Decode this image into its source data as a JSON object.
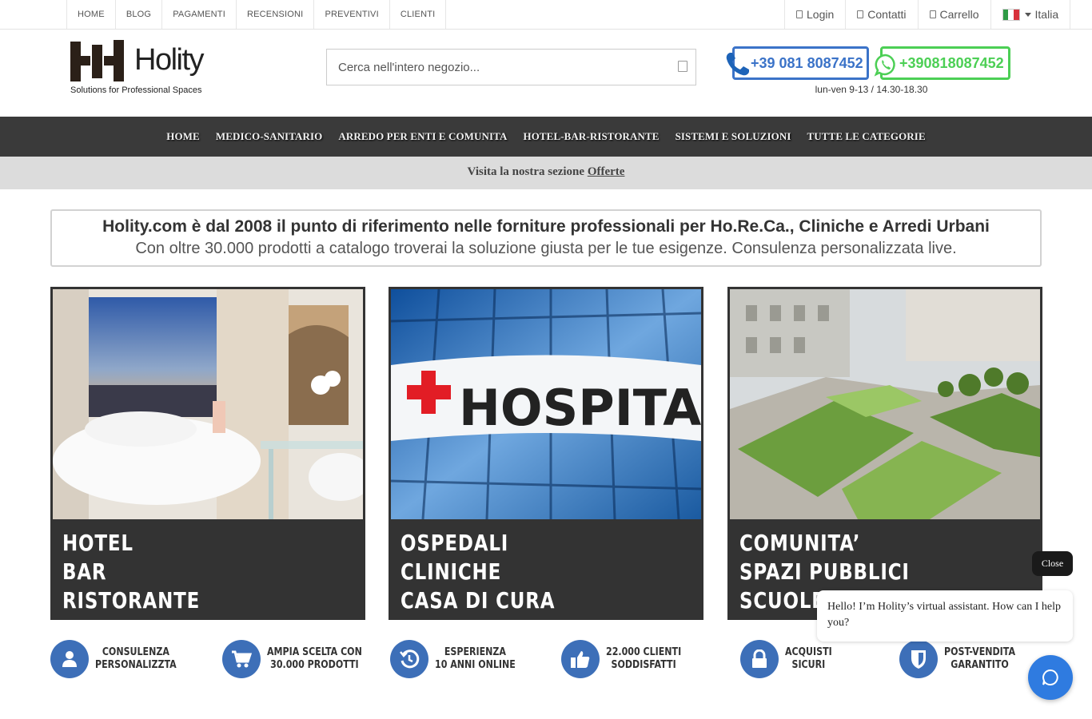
{
  "topbar": {
    "links": [
      "HOME",
      "BLOG",
      "PAGAMENTI",
      "RECENSIONI",
      "PREVENTIVI",
      "CLIENTI"
    ],
    "login": "Login",
    "contacts": "Contatti",
    "cart": "Carrello",
    "country": "Italia"
  },
  "header": {
    "logo_word": "Holity",
    "logo_tagline": "Solutions for Professional Spaces",
    "search_placeholder": "Cerca nell'intero negozio...",
    "phone": "+39 081 8087452",
    "whatsapp": "+390818087452",
    "hours": "lun-ven 9-13 / 14.30-18.30"
  },
  "mainnav": [
    "HOME",
    "MEDICO-SANITARIO",
    "ARREDO PER ENTI E COMUNITA",
    "HOTEL-BAR-RISTORANTE",
    "SISTEMI E SOLUZIONI",
    "TUTTE LE CATEGORIE"
  ],
  "offer": {
    "prefix": "Visita la nostra sezione",
    "link": "Offerte"
  },
  "intro": {
    "title": "Holity.com è dal 2008 il punto di riferimento nelle forniture professionali per Ho.Re.Ca., Cliniche e Arredi Urbani",
    "subtitle": "Con oltre 30.000 prodotti a catalogo troverai la soluzione giusta per le tue esigenze. Consulenza personalizzata live."
  },
  "cards": [
    {
      "lines": [
        "HOTEL",
        "BAR",
        "RISTORANTE"
      ]
    },
    {
      "lines": [
        "OSPEDALI",
        "CLINICHE",
        "CASA DI CURA"
      ],
      "photo_text": "HOSPITA"
    },
    {
      "lines": [
        "COMUNITA’",
        "SPAZI PUBBLICI",
        "SCUOLE"
      ]
    }
  ],
  "features": [
    {
      "icon": "user-icon",
      "lines": [
        "CONSULENZA",
        "PERSONALIZZTA"
      ]
    },
    {
      "icon": "cart-icon",
      "lines": [
        "AMPIA SCELTA CON",
        "30.000 PRODOTTI"
      ]
    },
    {
      "icon": "history-icon",
      "lines": [
        "ESPERIENZA",
        "10 ANNI ONLINE"
      ]
    },
    {
      "icon": "thumbs-up-icon",
      "lines": [
        "22.000 CLIENTI",
        "SODDISFATTI"
      ]
    },
    {
      "icon": "lock-icon",
      "lines": [
        "ACQUISTI",
        "SICURI"
      ]
    },
    {
      "icon": "shield-icon",
      "lines": [
        "POST-VENDITA",
        "GARANTITO"
      ]
    }
  ],
  "chat": {
    "close": "Close",
    "message": "Hello! I’m Holity’s virtual assistant. How can I help you?"
  },
  "colors": {
    "brand_blue": "#3b73c8",
    "whatsapp_green": "#4ccf55",
    "nav_bg": "#3a3a3a",
    "chat_blue": "#2f7be0"
  }
}
